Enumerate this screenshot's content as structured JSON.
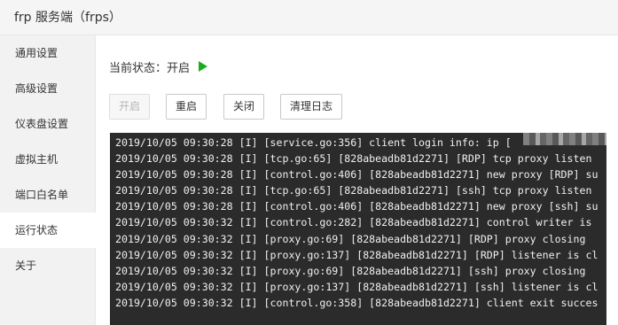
{
  "window": {
    "title": "frp 服务端（frps）"
  },
  "sidebar": {
    "items": [
      {
        "label": "通用设置",
        "active": false
      },
      {
        "label": "高级设置",
        "active": false
      },
      {
        "label": "仪表盘设置",
        "active": false
      },
      {
        "label": "虚拟主机",
        "active": false
      },
      {
        "label": "端口白名单",
        "active": false
      },
      {
        "label": "运行状态",
        "active": true
      },
      {
        "label": "关于",
        "active": false
      }
    ]
  },
  "status": {
    "label": "当前状态：",
    "value": "开启",
    "icon": "play-icon",
    "color": "#1aad19"
  },
  "toolbar": {
    "start_label": "开启",
    "restart_label": "重启",
    "stop_label": "关闭",
    "clear_log_label": "清理日志"
  },
  "log": {
    "lines": [
      "2019/10/05 09:30:28 [I] [service.go:356] client login info: ip [",
      "2019/10/05 09:30:28 [I] [tcp.go:65] [828abeadb81d2271] [RDP] tcp proxy listen",
      "2019/10/05 09:30:28 [I] [control.go:406] [828abeadb81d2271] new proxy [RDP] su",
      "2019/10/05 09:30:28 [I] [tcp.go:65] [828abeadb81d2271] [ssh] tcp proxy listen",
      "2019/10/05 09:30:28 [I] [control.go:406] [828abeadb81d2271] new proxy [ssh] su",
      "2019/10/05 09:30:32 [I] [control.go:282] [828abeadb81d2271] control writer is",
      "2019/10/05 09:30:32 [I] [proxy.go:69] [828abeadb81d2271] [RDP] proxy closing",
      "2019/10/05 09:30:32 [I] [proxy.go:137] [828abeadb81d2271] [RDP] listener is cl",
      "2019/10/05 09:30:32 [I] [proxy.go:69] [828abeadb81d2271] [ssh] proxy closing",
      "2019/10/05 09:30:32 [I] [proxy.go:137] [828abeadb81d2271] [ssh] listener is cl",
      "2019/10/05 09:30:32 [I] [control.go:358] [828abeadb81d2271] client exit succes"
    ]
  }
}
